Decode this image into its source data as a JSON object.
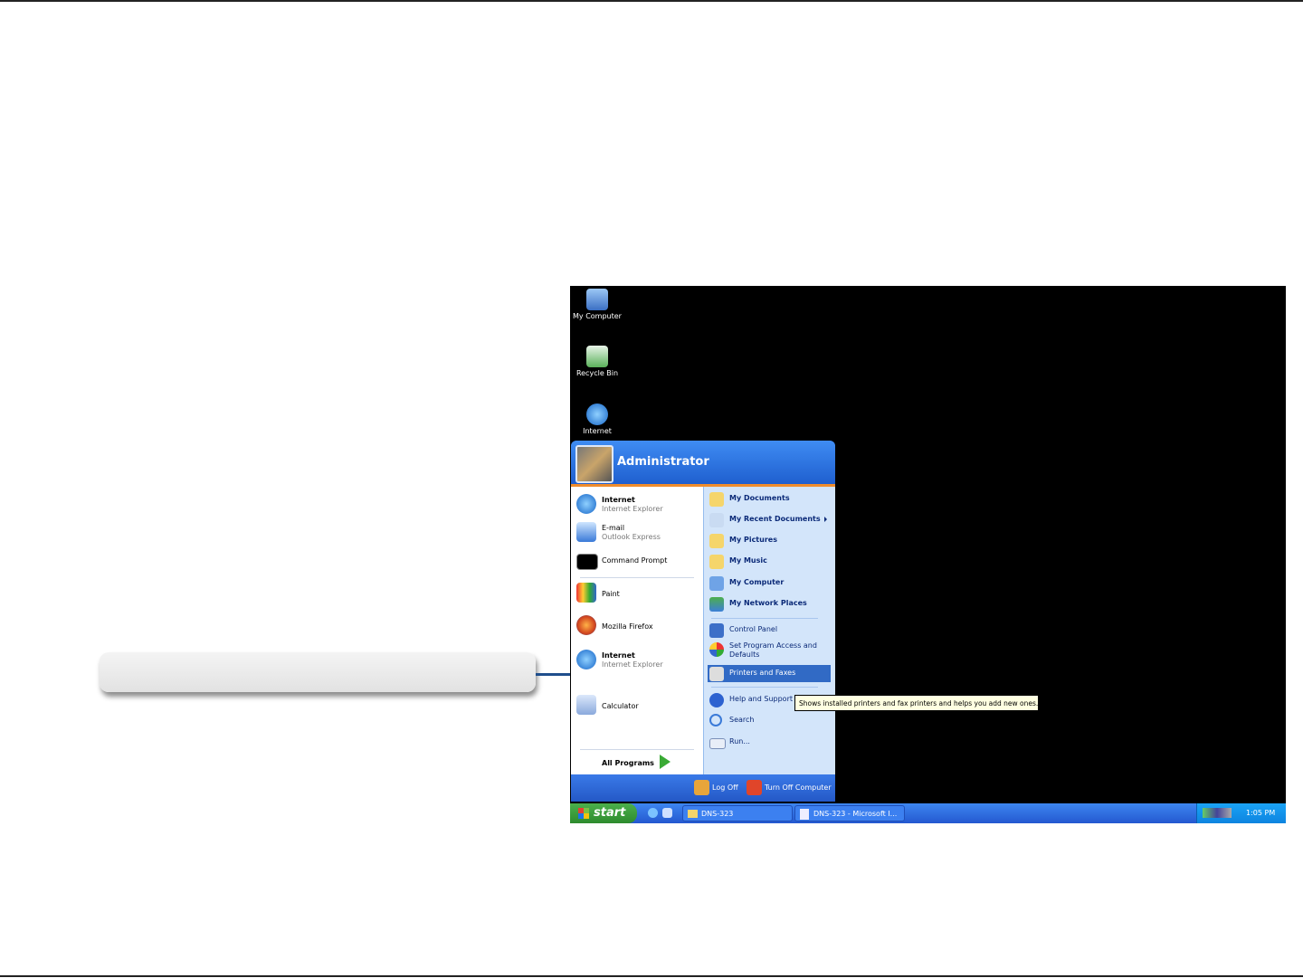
{
  "desktop": {
    "icons": [
      {
        "label": "My Computer",
        "icon": "my-computer-icon"
      },
      {
        "label": "Recycle Bin",
        "icon": "recycle-bin-icon"
      },
      {
        "label": "Internet",
        "icon": "internet-explorer-icon"
      }
    ]
  },
  "start_menu": {
    "user": "Administrator",
    "pinned": [
      {
        "title": "Internet",
        "subtitle": "Internet Explorer"
      },
      {
        "title": "E-mail",
        "subtitle": "Outlook Express"
      }
    ],
    "recent": [
      "Command Prompt",
      "Paint",
      "Mozilla Firefox",
      "Calculator"
    ],
    "recent_ie": {
      "title": "Internet",
      "subtitle": "Internet Explorer"
    },
    "all_programs": "All Programs",
    "right_items": [
      "My Documents",
      "My Recent Documents",
      "My Pictures",
      "My Music",
      "My Computer",
      "My Network Places"
    ],
    "right_items2": [
      "Control Panel",
      "Set Program Access and Defaults",
      "Printers and Faxes"
    ],
    "right_items3": [
      "Help and Support",
      "Search",
      "Run..."
    ],
    "log_off": "Log Off",
    "turn_off": "Turn Off Computer"
  },
  "tooltip": "Shows installed printers and fax printers and helps you add new ones.",
  "taskbar": {
    "start": "start",
    "tasks": [
      "DNS-323",
      "DNS-323 - Microsoft I..."
    ],
    "clock": "1:05 PM"
  },
  "colors": {
    "arrow": "#1f4e8c",
    "selected": "#316ac5"
  }
}
